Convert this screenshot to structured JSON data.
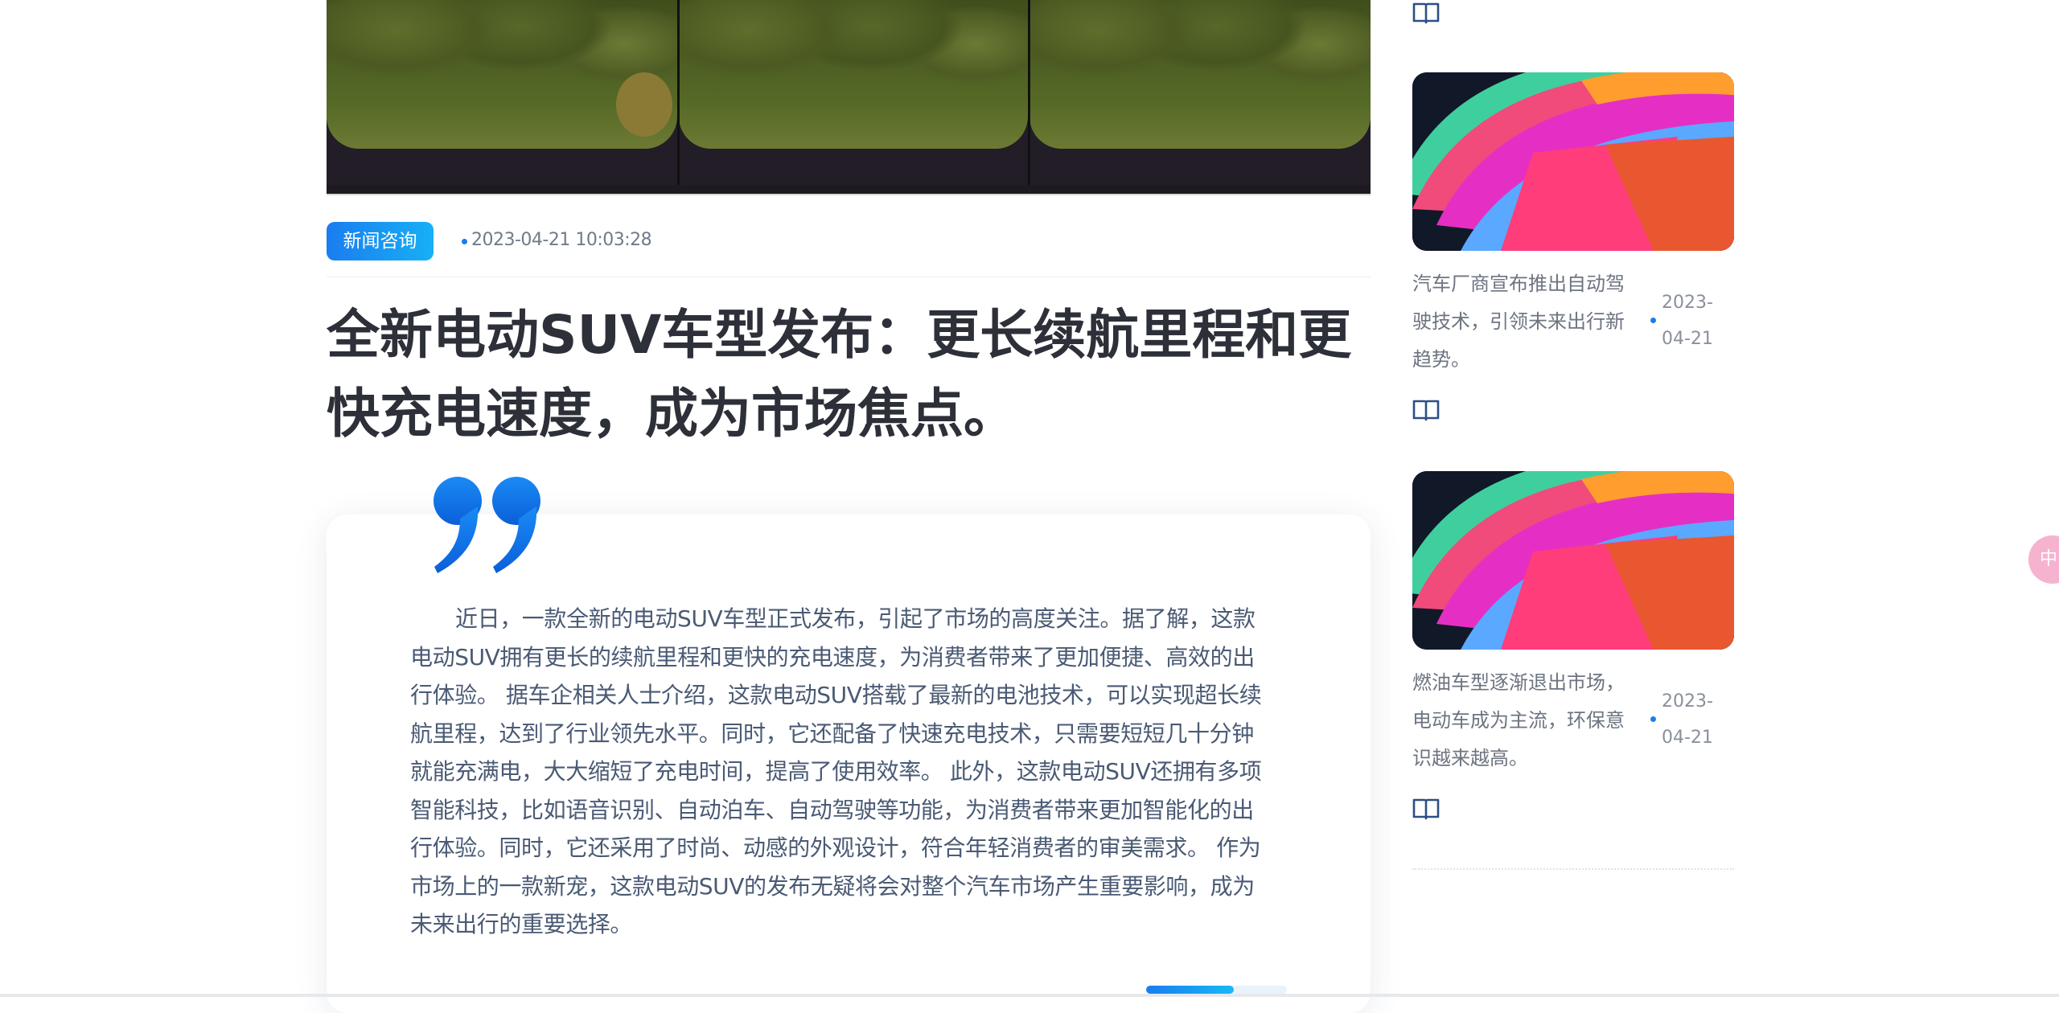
{
  "article": {
    "category": "新闻咨询",
    "date": "2023-04-21 10:03:28",
    "title": "全新电动SUV车型发布：更长续航里程和更快充电速度，成为市场焦点。",
    "body": "近日，一款全新的电动SUV车型正式发布，引起了市场的高度关注。据了解，这款电动SUV拥有更长的续航里程和更快的充电速度，为消费者带来了更加便捷、高效的出行体验。 据车企相关人士介绍，这款电动SUV搭载了最新的电池技术，可以实现超长续航里程，达到了行业领先水平。同时，它还配备了快速充电技术，只需要短短几十分钟就能充满电，大大缩短了充电时间，提高了使用效率。 此外，这款电动SUV还拥有多项智能科技，比如语音识别、自动泊车、自动驾驶等功能，为消费者带来更加智能化的出行体验。同时，它还采用了时尚、动感的外观设计，符合年轻消费者的审美需求。 作为市场上的一款新宠，这款电动SUV的发布无疑将会对整个汽车市场产生重要影响，成为未来出行的重要选择。",
    "reading_progress_percent": 62
  },
  "sidebar": {
    "items": [
      {
        "title": "汽车厂商宣布推出自动驾驶技术，引领未来出行新趋势。",
        "date": "2023-04-21",
        "icon": "book-icon"
      },
      {
        "title": "燃油车型逐渐退出市场，电动车成为主流，环保意识越来越高。",
        "date": "2023-04-21",
        "icon": "book-icon"
      }
    ]
  },
  "floating_button": {
    "label": "中"
  },
  "colors": {
    "accent": "#1b7cf0",
    "accent_light": "#17b0f5",
    "title": "#2d3038",
    "body_text": "#4a5a74"
  }
}
